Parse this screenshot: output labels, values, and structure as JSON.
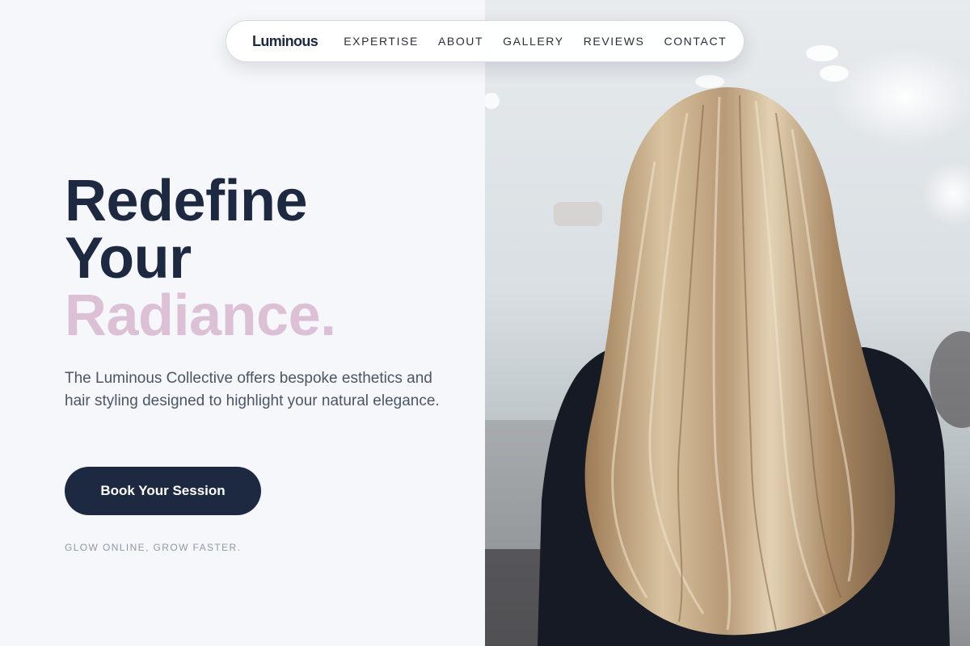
{
  "nav": {
    "logo": "Luminous",
    "links": [
      "EXPERTISE",
      "ABOUT",
      "GALLERY",
      "REVIEWS",
      "CONTACT"
    ]
  },
  "hero": {
    "title_line1": "Redefine",
    "title_line2": "Your",
    "title_accent": "Radiance.",
    "description": "The Luminous Collective offers bespoke esthetics and hair styling designed to highlight your natural elegance.",
    "cta_label": "Book Your Session",
    "tagline": "GLOW ONLINE, GROW FASTER."
  },
  "colors": {
    "primary": "#1d2940",
    "accent": "#dcc0d6",
    "background": "#f6f7fb"
  }
}
